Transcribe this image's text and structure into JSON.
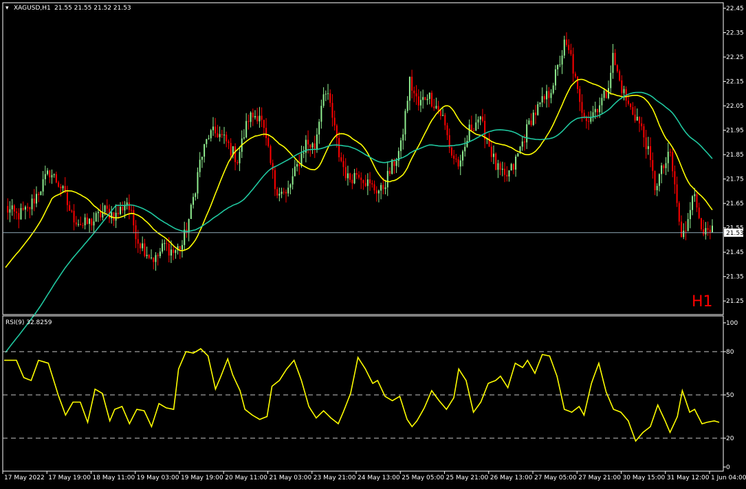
{
  "chart_data": [
    {
      "type": "candlestick",
      "info": {
        "symbol_label": "XAGUSD,H1",
        "ohlc_text": "21.55 21.55 21.52 21.53"
      },
      "timeframe_label": "H1",
      "ylim": [
        21.2,
        22.45
      ],
      "y_ticks": [
        "22.45",
        "22.35",
        "22.25",
        "22.15",
        "22.05",
        "21.95",
        "21.85",
        "21.75",
        "21.65",
        "21.55",
        "21.45",
        "21.35",
        "21.25"
      ],
      "current_price": "21.53",
      "x_ticks": [
        "17 May 2022",
        "17 May 19:00",
        "18 May 11:00",
        "19 May 03:00",
        "19 May 19:00",
        "20 May 11:00",
        "21 May 03:00",
        "23 May 21:00",
        "24 May 13:00",
        "25 May 05:00",
        "25 May 21:00",
        "26 May 13:00",
        "27 May 05:00",
        "27 May 21:00",
        "30 May 15:00",
        "31 May 12:00",
        "1 Jun 04:00"
      ],
      "close_anchors": [
        [
          0,
          21.63
        ],
        [
          5,
          21.6
        ],
        [
          10,
          21.62
        ],
        [
          15,
          21.7
        ],
        [
          20,
          21.78
        ],
        [
          25,
          21.72
        ],
        [
          30,
          21.6
        ],
        [
          35,
          21.56
        ],
        [
          40,
          21.58
        ],
        [
          45,
          21.62
        ],
        [
          50,
          21.6
        ],
        [
          55,
          21.66
        ],
        [
          60,
          21.5
        ],
        [
          65,
          21.44
        ],
        [
          68,
          21.42
        ],
        [
          72,
          21.48
        ],
        [
          76,
          21.45
        ],
        [
          80,
          21.48
        ],
        [
          84,
          21.62
        ],
        [
          88,
          21.82
        ],
        [
          92,
          21.93
        ],
        [
          96,
          21.94
        ],
        [
          100,
          21.9
        ],
        [
          105,
          21.83
        ],
        [
          110,
          22.0
        ],
        [
          115,
          22.02
        ],
        [
          118,
          21.9
        ],
        [
          122,
          21.72
        ],
        [
          127,
          21.68
        ],
        [
          132,
          21.8
        ],
        [
          136,
          21.9
        ],
        [
          140,
          21.88
        ],
        [
          144,
          22.12
        ],
        [
          147,
          22.05
        ],
        [
          151,
          21.85
        ],
        [
          155,
          21.75
        ],
        [
          160,
          21.78
        ],
        [
          165,
          21.72
        ],
        [
          170,
          21.7
        ],
        [
          175,
          21.8
        ],
        [
          179,
          21.88
        ],
        [
          183,
          22.15
        ],
        [
          187,
          22.05
        ],
        [
          191,
          22.1
        ],
        [
          195,
          22.05
        ],
        [
          198,
          22.0
        ],
        [
          202,
          21.85
        ],
        [
          206,
          21.8
        ],
        [
          210,
          21.95
        ],
        [
          214,
          22.0
        ],
        [
          218,
          21.92
        ],
        [
          222,
          21.8
        ],
        [
          226,
          21.75
        ],
        [
          230,
          21.8
        ],
        [
          234,
          21.9
        ],
        [
          238,
          22.0
        ],
        [
          242,
          22.05
        ],
        [
          246,
          22.1
        ],
        [
          250,
          22.2
        ],
        [
          253,
          22.3
        ],
        [
          256,
          22.25
        ],
        [
          260,
          22.05
        ],
        [
          264,
          22.0
        ],
        [
          268,
          22.05
        ],
        [
          272,
          22.1
        ],
        [
          275,
          22.25
        ],
        [
          278,
          22.15
        ],
        [
          282,
          22.05
        ],
        [
          286,
          22.0
        ],
        [
          290,
          21.9
        ],
        [
          294,
          21.72
        ],
        [
          298,
          21.8
        ],
        [
          301,
          21.85
        ],
        [
          304,
          21.65
        ],
        [
          306,
          21.5
        ],
        [
          308,
          21.55
        ],
        [
          311,
          21.7
        ],
        [
          314,
          21.6
        ],
        [
          317,
          21.52
        ],
        [
          320,
          21.53
        ]
      ],
      "series": [
        {
          "name": "",
          "type": "ma",
          "period": 21,
          "color": "#ffff00"
        },
        {
          "name": "",
          "type": "ma",
          "period": 50,
          "color": "#20c8a0"
        }
      ],
      "colors": {
        "bull": "#90ee90",
        "bear": "#ff0000",
        "price_line": "#8faab8",
        "background": "#000000",
        "text": "#ffffff",
        "timeframe": "#ff0000"
      }
    },
    {
      "type": "line",
      "title": "RSI(9) 32.8259",
      "ylim": [
        0,
        100
      ],
      "y_ticks": [
        "100",
        "80",
        "50",
        "20",
        "0"
      ],
      "levels": [
        80,
        50,
        20
      ],
      "anchors": [
        [
          0,
          74
        ],
        [
          5,
          74
        ],
        [
          8,
          62
        ],
        [
          11,
          60
        ],
        [
          14,
          74
        ],
        [
          18,
          72
        ],
        [
          22,
          50
        ],
        [
          25,
          36
        ],
        [
          28,
          45
        ],
        [
          31,
          45
        ],
        [
          34,
          31
        ],
        [
          37,
          54
        ],
        [
          40,
          51
        ],
        [
          43,
          32
        ],
        [
          45,
          40
        ],
        [
          48,
          42
        ],
        [
          51,
          30
        ],
        [
          54,
          40
        ],
        [
          57,
          39
        ],
        [
          60,
          28
        ],
        [
          63,
          44
        ],
        [
          66,
          41
        ],
        [
          69,
          40
        ],
        [
          71,
          68
        ],
        [
          74,
          80
        ],
        [
          77,
          79
        ],
        [
          80,
          82
        ],
        [
          83,
          77
        ],
        [
          86,
          54
        ],
        [
          88,
          62
        ],
        [
          91,
          75
        ],
        [
          93,
          64
        ],
        [
          96,
          53
        ],
        [
          98,
          40
        ],
        [
          101,
          36
        ],
        [
          104,
          33
        ],
        [
          107,
          35
        ],
        [
          109,
          56
        ],
        [
          112,
          60
        ],
        [
          115,
          68
        ],
        [
          118,
          74
        ],
        [
          121,
          60
        ],
        [
          124,
          42
        ],
        [
          127,
          34
        ],
        [
          130,
          39
        ],
        [
          133,
          34
        ],
        [
          136,
          30
        ],
        [
          138,
          38
        ],
        [
          141,
          51
        ],
        [
          144,
          76
        ],
        [
          147,
          68
        ],
        [
          150,
          58
        ],
        [
          152,
          60
        ],
        [
          155,
          49
        ],
        [
          158,
          46
        ],
        [
          161,
          49
        ],
        [
          164,
          33
        ],
        [
          166,
          28
        ],
        [
          168,
          32
        ],
        [
          171,
          41
        ],
        [
          174,
          53
        ],
        [
          177,
          46
        ],
        [
          180,
          40
        ],
        [
          183,
          48
        ],
        [
          185,
          68
        ],
        [
          188,
          60
        ],
        [
          191,
          38
        ],
        [
          194,
          45
        ],
        [
          197,
          58
        ],
        [
          200,
          60
        ],
        [
          202,
          63
        ],
        [
          205,
          55
        ],
        [
          208,
          72
        ],
        [
          211,
          69
        ],
        [
          213,
          74
        ],
        [
          216,
          65
        ],
        [
          219,
          78
        ],
        [
          222,
          77
        ],
        [
          225,
          63
        ],
        [
          228,
          40
        ],
        [
          231,
          38
        ],
        [
          234,
          42
        ],
        [
          236,
          36
        ],
        [
          239,
          58
        ],
        [
          242,
          72
        ],
        [
          245,
          52
        ],
        [
          248,
          40
        ],
        [
          251,
          38
        ],
        [
          254,
          32
        ],
        [
          257,
          18
        ],
        [
          260,
          24
        ],
        [
          263,
          28
        ],
        [
          266,
          43
        ],
        [
          269,
          32
        ],
        [
          271,
          24
        ],
        [
          274,
          35
        ],
        [
          276,
          53
        ],
        [
          279,
          38
        ],
        [
          281,
          40
        ],
        [
          284,
          30
        ],
        [
          286,
          31
        ],
        [
          289,
          32
        ],
        [
          291,
          31
        ]
      ],
      "line_color": "#ffff00"
    }
  ]
}
